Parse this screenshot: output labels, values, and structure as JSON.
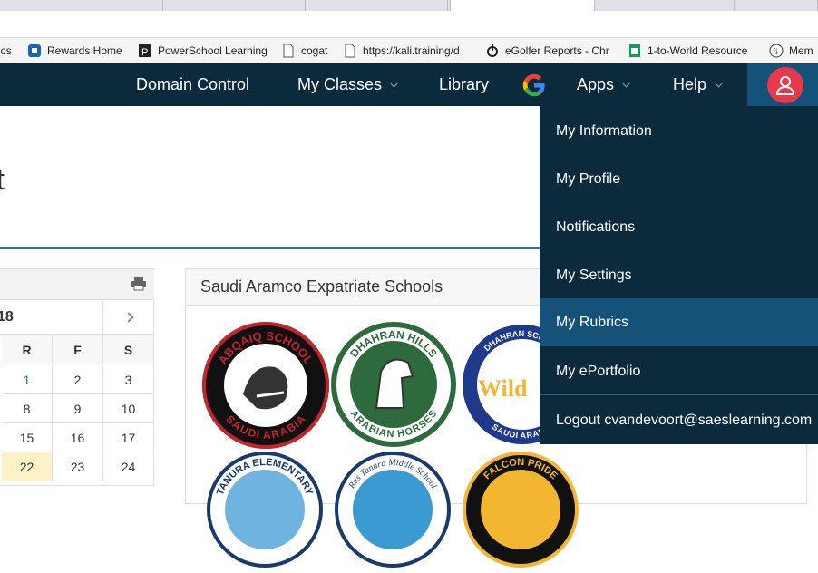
{
  "bookmarks": [
    {
      "label": "ics"
    },
    {
      "label": "Rewards Home"
    },
    {
      "label": "PowerSchool Learning"
    },
    {
      "label": "cogat"
    },
    {
      "label": "https://kali.training/d"
    },
    {
      "label": "eGolfer Reports - Chr"
    },
    {
      "label": "1-to-World Resource"
    },
    {
      "label": "Mem"
    }
  ],
  "nav": {
    "domain_control": "Domain Control",
    "my_classes": "My Classes",
    "library": "Library",
    "apps": "Apps",
    "help": "Help"
  },
  "page": {
    "title_fragment": "t"
  },
  "calendar": {
    "month_fragment": "18",
    "day_headers": [
      "R",
      "F",
      "S"
    ],
    "rows": [
      [
        "1",
        "2",
        "3"
      ],
      [
        "8",
        "9",
        "10"
      ],
      [
        "15",
        "16",
        "17"
      ],
      [
        "22",
        "23",
        "24"
      ]
    ]
  },
  "schools": {
    "title": "Saudi Aramco Expatriate Schools",
    "logos": [
      {
        "name": "ABQAIQ SCHOOL",
        "subtitle": "SAUDI ARABIA"
      },
      {
        "name": "DHAHRAN HILLS",
        "subtitle": "ARABIAN HORSES"
      },
      {
        "name": "DHAHRAN SCHOOL",
        "subtitle": "SAUDI ARABIA"
      },
      {
        "name": "TANURA ELEMENTARY"
      },
      {
        "name": "Ras Tanura Middle School"
      },
      {
        "name": "FALCON PRIDE"
      }
    ]
  },
  "user_menu": {
    "items": [
      {
        "label": "My Information"
      },
      {
        "label": "My Profile"
      },
      {
        "label": "Notifications"
      },
      {
        "label": "My Settings"
      },
      {
        "label": "My Rubrics"
      },
      {
        "label": "My ePortfolio"
      }
    ],
    "logout": "Logout cvandevoort@saeslearning.com",
    "active_item": "My Rubrics"
  },
  "colors": {
    "nav_bg": "#0b2a3c",
    "nav_active": "#14527a",
    "avatar": "#e8384a",
    "accent_rule": "#2a78a8"
  }
}
